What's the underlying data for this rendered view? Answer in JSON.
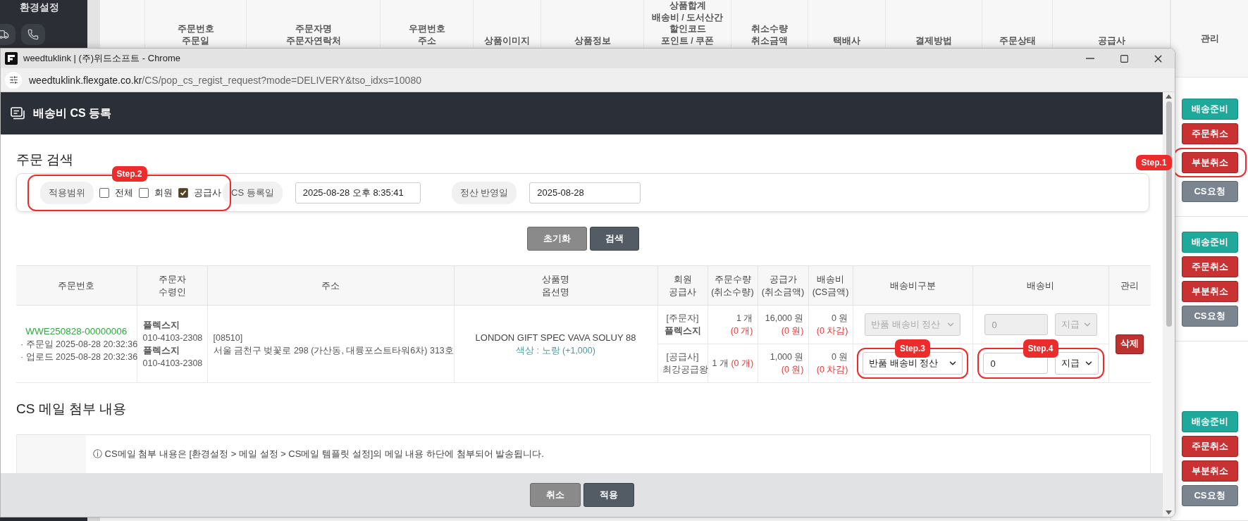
{
  "sidebar": {
    "menu_label": "환경설정"
  },
  "background_table": {
    "columns": [
      {
        "lines": [
          "주문번호",
          "주문일"
        ]
      },
      {
        "lines": [
          "주문자명",
          "주문자연락처"
        ]
      },
      {
        "lines": [
          "우편번호",
          "주소"
        ]
      },
      {
        "lines": [
          "상품이미지"
        ]
      },
      {
        "lines": [
          "상품정보"
        ]
      },
      {
        "lines": [
          "상품합계",
          "배송비 / 도서산간",
          "할인코드",
          "포인트 / 쿠폰"
        ]
      },
      {
        "lines": [
          "취소수량",
          "취소금액"
        ]
      },
      {
        "lines": [
          "택배사"
        ]
      },
      {
        "lines": [
          "결제방법"
        ]
      },
      {
        "lines": [
          "주문상태"
        ]
      },
      {
        "lines": [
          "공급사"
        ]
      }
    ]
  },
  "manage_column": {
    "header": "관리",
    "groups": [
      {
        "buttons": [
          {
            "label": "배송준비",
            "kind": "ready"
          },
          {
            "label": "주문취소",
            "kind": "cancel"
          },
          {
            "label": "부분취소",
            "kind": "cancel",
            "callout": "Step.1"
          },
          {
            "label": "CS요청",
            "kind": "cs"
          }
        ]
      },
      {
        "buttons": [
          {
            "label": "배송준비",
            "kind": "ready"
          },
          {
            "label": "주문취소",
            "kind": "cancel"
          },
          {
            "label": "부분취소",
            "kind": "cancel"
          },
          {
            "label": "CS요청",
            "kind": "cs"
          }
        ]
      },
      {
        "buttons": [
          {
            "label": "배송준비",
            "kind": "ready"
          },
          {
            "label": "주문취소",
            "kind": "cancel"
          },
          {
            "label": "부분취소",
            "kind": "cancel"
          },
          {
            "label": "CS요청",
            "kind": "cs"
          }
        ]
      }
    ]
  },
  "window": {
    "title": "weedtuklink | (주)위드소프트 - Chrome",
    "url_host": "weedtuklink.flexgate.co.kr",
    "url_path": "/CS/pop_cs_regist_request?mode=DELIVERY&tso_idxs=10080"
  },
  "popup": {
    "header": "배송비 CS 등록",
    "search_title": "주문 검색",
    "filters": {
      "scope": {
        "label": "적용범위",
        "callout": "Step.2",
        "options": [
          {
            "label": "전체",
            "checked": false
          },
          {
            "label": "회원",
            "checked": false
          },
          {
            "label": "공급사",
            "checked": true
          }
        ]
      },
      "cs_date": {
        "label": "CS 등록일",
        "value": "2025-08-28 오후 8:35:41"
      },
      "settle_date": {
        "label": "정산 반영일",
        "value": "2025-08-28"
      }
    },
    "reset_button": "초기화",
    "search_button": "검색",
    "table": {
      "columns": [
        {
          "lines": [
            "주문번호"
          ]
        },
        {
          "lines": [
            "주문자",
            "수령인"
          ]
        },
        {
          "lines": [
            "주소"
          ]
        },
        {
          "lines": [
            "상품명",
            "옵션명"
          ]
        },
        {
          "lines": [
            "회원",
            "공급사"
          ]
        },
        {
          "lines": [
            "주문수량",
            "(취소수량)"
          ]
        },
        {
          "lines": [
            "공급가",
            "(취소금액)"
          ]
        },
        {
          "lines": [
            "배송비",
            "(CS금액)"
          ]
        },
        {
          "lines": [
            "배송비구분"
          ]
        },
        {
          "lines": [
            "배송비"
          ]
        },
        {
          "lines": [
            "관리"
          ]
        }
      ],
      "order": {
        "order_no": "WWE250828-00000006",
        "order_date": "· 주문일 2025-08-28 20:32:36",
        "upload_date": "· 업로드 2025-08-28 20:32:36",
        "orderer_name": "플렉스지",
        "orderer_phone": "010-4103-2308",
        "receiver_name": "플렉스지",
        "receiver_phone": "010-4103-2308",
        "zip": "[08510]",
        "address": "서울 금천구 벚꽃로 298 (가산동, 대륭포스트타워6차) 313호",
        "product": "LONDON GIFT SPEC VAVA SOLUY 88",
        "option": "색상 : 노랑 (+1,000)",
        "delete_button": "삭제"
      },
      "rows": [
        {
          "kind": "buyer",
          "party_label": "[주문자]",
          "party_name": "플렉스지",
          "qty": "1 개",
          "qty_cancel": "(0 개)",
          "supply": "16,000 원",
          "supply_cancel": "(0 원)",
          "ship": "0 원",
          "ship_cs": "(0 차감)",
          "fee_type": {
            "value": "반품 배송비 정산",
            "disabled": true
          },
          "fee": {
            "value": "0",
            "disabled": true
          },
          "pay": {
            "value": "지급",
            "disabled": true
          }
        },
        {
          "kind": "supplier",
          "party_label": "[공급사]",
          "party_name": "최강공급왕",
          "qty": "1 개",
          "qty_cancel": "(0 개)",
          "supply": "1,000 원",
          "supply_cancel": "(0 원)",
          "ship": "0 원",
          "ship_cs": "(0 차감)",
          "fee_type": {
            "value": "반품 배송비 정산",
            "disabled": false,
            "callout": "Step.3"
          },
          "fee": {
            "value": "0",
            "disabled": false,
            "callout": "Step.4"
          },
          "pay": {
            "value": "지급",
            "disabled": false
          }
        }
      ]
    },
    "mail_title": "CS 메일 첨부 내용",
    "mail_notice": "ⓘ CS메일 첨부 내용은 [환경설정 > 메일 설정 > CS메일 템플릿 설정]의 메일 내용 하단에 첨부되어 발송됩니다.",
    "cancel_button": "취소",
    "apply_button": "적용"
  }
}
